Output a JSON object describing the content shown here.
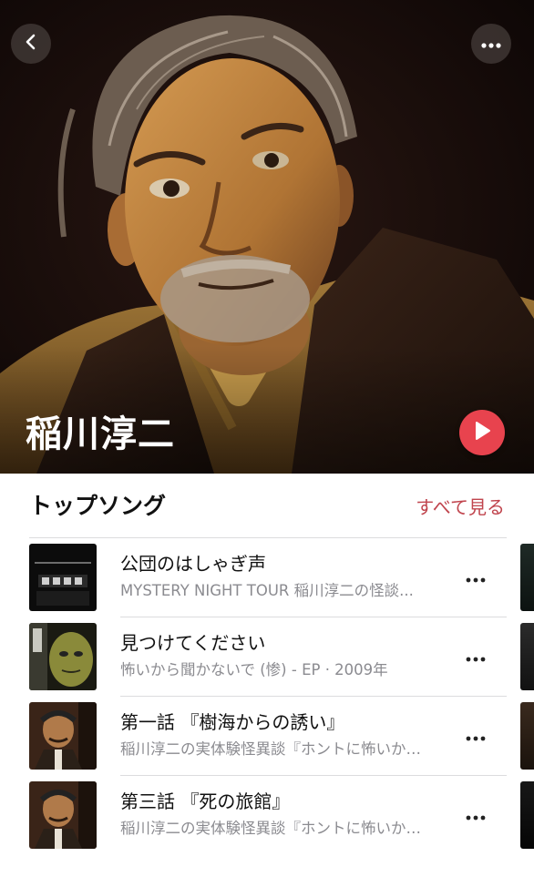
{
  "header": {
    "back_icon": "chevron-left-icon",
    "more_icon": "ellipsis-icon"
  },
  "artist": {
    "name": "稲川淳二",
    "play_icon": "play-icon"
  },
  "top_songs": {
    "title": "トップソング",
    "see_all": "すべて見る",
    "items": [
      {
        "title": "公団のはしゃぎ声",
        "subtitle": "MYSTERY NIGHT TOUR 稲川淳二の怪談...",
        "more_icon": "ellipsis-icon"
      },
      {
        "title": "見つけてください",
        "subtitle": "怖いから聞かないで (惨) - EP · 2009年",
        "more_icon": "ellipsis-icon"
      },
      {
        "title": "第一話 『樹海からの誘い』",
        "subtitle": "稲川淳二の実体験怪異談『ホントに怖いか…",
        "more_icon": "ellipsis-icon"
      },
      {
        "title": "第三話 『死の旅館』",
        "subtitle": "稲川淳二の実体験怪異談『ホントに怖いか…",
        "more_icon": "ellipsis-icon"
      }
    ]
  },
  "colors": {
    "accent": "#c0444d",
    "play_button": "#e8434e",
    "secondary_text": "#8b8b90"
  }
}
